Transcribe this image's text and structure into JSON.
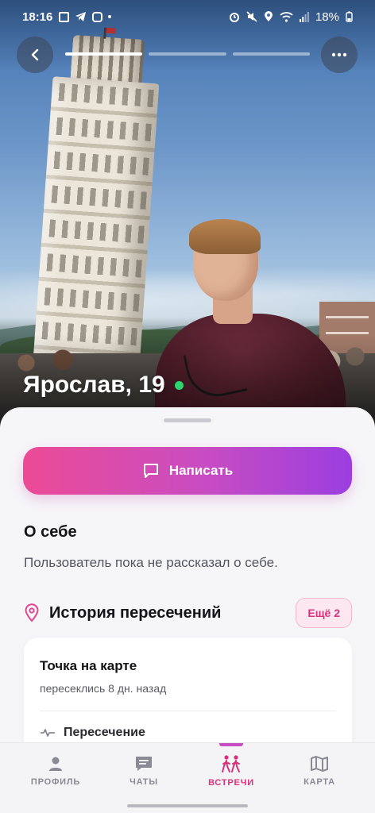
{
  "status_bar": {
    "time": "18:16",
    "battery": "18%"
  },
  "photo": {
    "progress_segments": 3,
    "active_segment": 0
  },
  "profile": {
    "name": "Ярослав, 19",
    "online": true
  },
  "actions": {
    "write_label": "Написать"
  },
  "about": {
    "title": "О себе",
    "text": "Пользователь пока не рассказал о себе."
  },
  "history": {
    "title": "История пересечений",
    "more_label": "Ещё 2",
    "card": {
      "title": "Точка на карте",
      "subtitle": "пересеклись 8 дн. назад",
      "row_label": "Пересечение"
    }
  },
  "nav": {
    "items": [
      {
        "label": "ПРОФИЛЬ",
        "icon": "person-icon"
      },
      {
        "label": "ЧАТЫ",
        "icon": "chat-icon"
      },
      {
        "label": "ВСТРЕЧИ",
        "icon": "meetings-icon"
      },
      {
        "label": "КАРТА",
        "icon": "map-icon"
      }
    ],
    "active_index": 2
  },
  "colors": {
    "accent_pink": "#d8327c",
    "gradient_start": "#ec4b95",
    "gradient_end": "#9b3ee0",
    "online": "#2dd36f"
  }
}
